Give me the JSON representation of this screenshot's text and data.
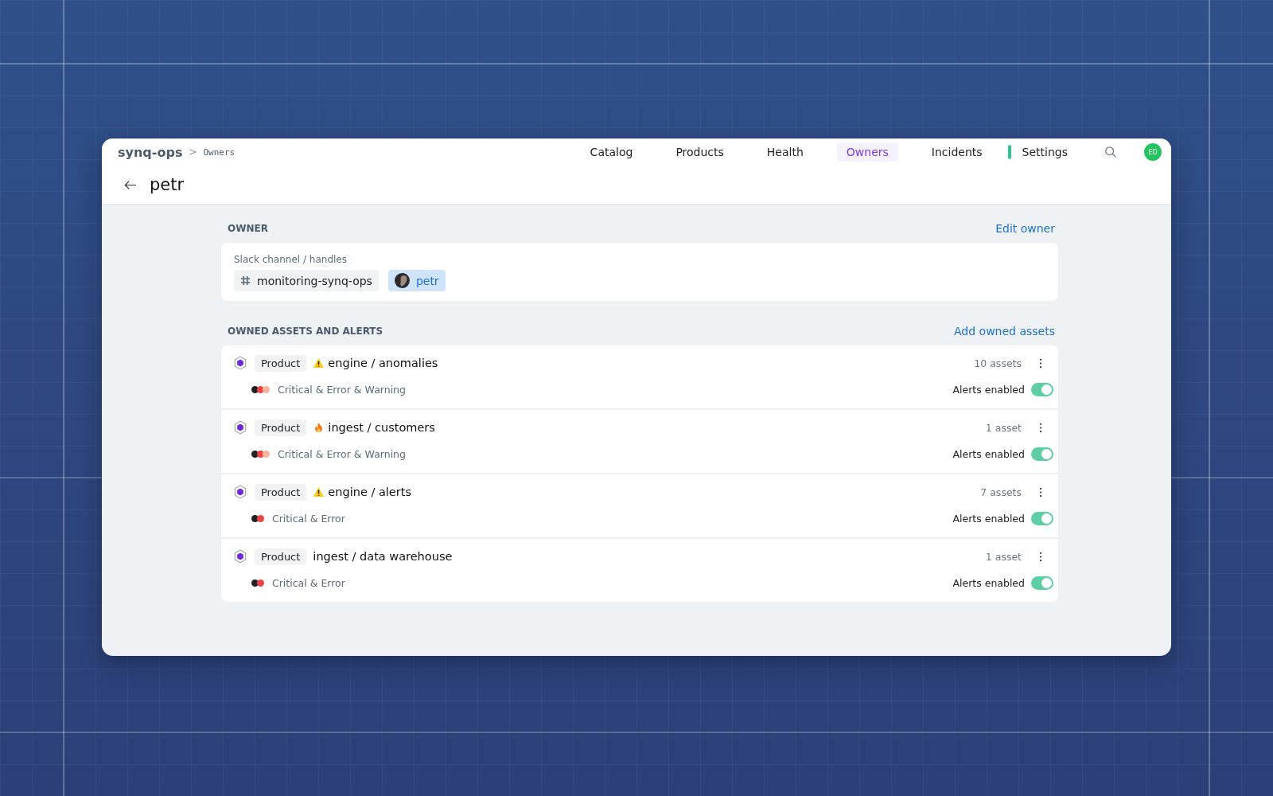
{
  "breadcrumb": {
    "workspace": "synq-ops",
    "separator": ">",
    "page": "Owners"
  },
  "nav": [
    {
      "label": "Catalog",
      "selected": false,
      "indicator": false
    },
    {
      "label": "Products",
      "selected": false,
      "indicator": false
    },
    {
      "label": "Health",
      "selected": false,
      "indicator": false
    },
    {
      "label": "Owners",
      "selected": true,
      "indicator": false
    },
    {
      "label": "Incidents",
      "selected": false,
      "indicator": false
    },
    {
      "label": "Settings",
      "selected": false,
      "indicator": true
    }
  ],
  "user": {
    "initials": "ED"
  },
  "title": "petr",
  "owner_section": {
    "heading": "OWNER",
    "action": "Edit owner",
    "field_label": "Slack channel / handles",
    "handles": [
      {
        "kind": "channel",
        "label": "monitoring-synq-ops"
      },
      {
        "kind": "user",
        "label": "petr"
      }
    ]
  },
  "assets_section": {
    "heading": "OWNED ASSETS AND ALERTS",
    "action": "Add owned assets",
    "rows": [
      {
        "type": "Product",
        "kind": "warning",
        "name": "engine / anomalies",
        "count": "10 assets",
        "severity": "Critical & Error & Warning",
        "dots": [
          {
            "color": "#1f2328"
          },
          {
            "color": "#ef4444"
          },
          {
            "color": "#fbb49a"
          }
        ],
        "toggle_label": "Alerts enabled",
        "on": true
      },
      {
        "type": "Product",
        "kind": "fire",
        "name": "ingest / customers",
        "count": "1 asset",
        "severity": "Critical & Error & Warning",
        "dots": [
          {
            "color": "#1f2328"
          },
          {
            "color": "#ef4444"
          },
          {
            "color": "#fbb49a"
          }
        ],
        "toggle_label": "Alerts enabled",
        "on": true
      },
      {
        "type": "Product",
        "kind": "warning",
        "name": "engine / alerts",
        "count": "7 assets",
        "severity": "Critical & Error",
        "dots": [
          {
            "color": "#1f2328"
          },
          {
            "color": "#ef4444"
          }
        ],
        "toggle_label": "Alerts enabled",
        "on": true
      },
      {
        "type": "Product",
        "kind": "plain",
        "name": "ingest / data warehouse",
        "count": "1 asset",
        "severity": "Critical & Error",
        "dots": [
          {
            "color": "#1f2328"
          },
          {
            "color": "#ef4444"
          }
        ],
        "toggle_label": "Alerts enabled",
        "on": true
      }
    ]
  }
}
